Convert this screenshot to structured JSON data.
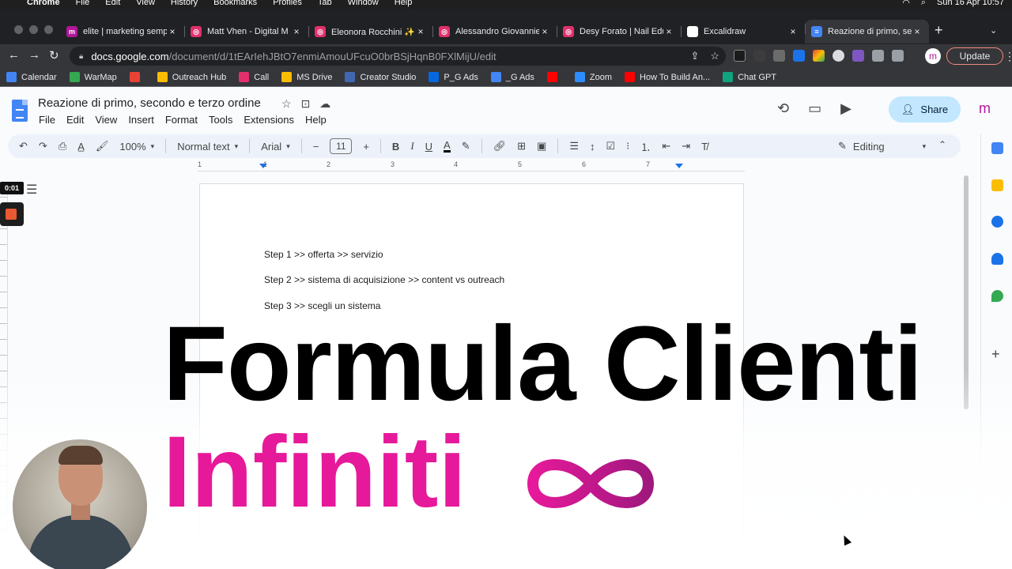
{
  "menubar": {
    "apple": "",
    "items": [
      "Chrome",
      "File",
      "Edit",
      "View",
      "History",
      "Bookmarks",
      "Profiles",
      "Tab",
      "Window",
      "Help"
    ],
    "clock": "Sun 16 Apr  10:57"
  },
  "tabs": [
    {
      "title": "elite | marketing semp",
      "favicon_color": "#b3179a",
      "favicon_letter": "m"
    },
    {
      "title": "Matt Vhen - Digital M",
      "favicon_color": "#e1306c",
      "favicon_letter": "◎"
    },
    {
      "title": "Eleonora Rocchini ✨",
      "favicon_color": "#e1306c",
      "favicon_letter": "◎"
    },
    {
      "title": "Alessandro Giovannie",
      "favicon_color": "#e1306c",
      "favicon_letter": "◎"
    },
    {
      "title": "Desy Forato | Nail Edu",
      "favicon_color": "#e1306c",
      "favicon_letter": "◎"
    },
    {
      "title": "Excalidraw",
      "favicon_color": "#ffffff",
      "favicon_letter": ""
    },
    {
      "title": "Reazione di primo, se",
      "favicon_color": "#4285f4",
      "favicon_letter": "≡"
    }
  ],
  "omnibox": {
    "host": "docs.google.com",
    "path": "/document/d/1tEArIehJBtO7enmiAmouUFcuO0brBSjHqnB0FXlMijU/edit"
  },
  "update_label": "Update",
  "profile_letter": "m",
  "bookmarks": [
    {
      "label": "Calendar",
      "color": "#4285f4"
    },
    {
      "label": "WarMap",
      "color": "#34a853"
    },
    {
      "label": "",
      "color": "#ea4335"
    },
    {
      "label": "Outreach Hub",
      "color": "#fbbc04"
    },
    {
      "label": "Call",
      "color": "#e1306c"
    },
    {
      "label": "MS Drive",
      "color": "#fbbc04"
    },
    {
      "label": "Creator Studio",
      "color": "#4267b2"
    },
    {
      "label": "P_G Ads",
      "color": "#0668e1"
    },
    {
      "label": "_G Ads",
      "color": "#4285f4"
    },
    {
      "label": "",
      "color": "#ff0000"
    },
    {
      "label": "Zoom",
      "color": "#2d8cff"
    },
    {
      "label": "How To Build An...",
      "color": "#ff0000"
    },
    {
      "label": "Chat GPT",
      "color": "#10a37f"
    }
  ],
  "doc": {
    "title": "Reazione di primo, secondo e terzo ordine",
    "menus": [
      "File",
      "Edit",
      "View",
      "Insert",
      "Format",
      "Tools",
      "Extensions",
      "Help"
    ],
    "share_label": "Share",
    "account_letter": "m"
  },
  "toolbar": {
    "zoom": "100%",
    "style": "Normal text",
    "font": "Arial",
    "font_size": "11",
    "mode": "Editing"
  },
  "ruler_numbers": [
    "1",
    "1",
    "2",
    "3",
    "4",
    "5",
    "6",
    "7"
  ],
  "recorder": {
    "timer": "0:01"
  },
  "content": {
    "lines": [
      "Step 1 >> offerta >> servizio",
      "Step 2 >> sistema di acquisizione >> content vs outreach",
      "Step 3 >> scegli un sistema"
    ]
  },
  "overlay": {
    "title": "Formula Clienti",
    "subtitle": "Infiniti",
    "title_color": "#000000",
    "subtitle_color": "#e6199a"
  }
}
